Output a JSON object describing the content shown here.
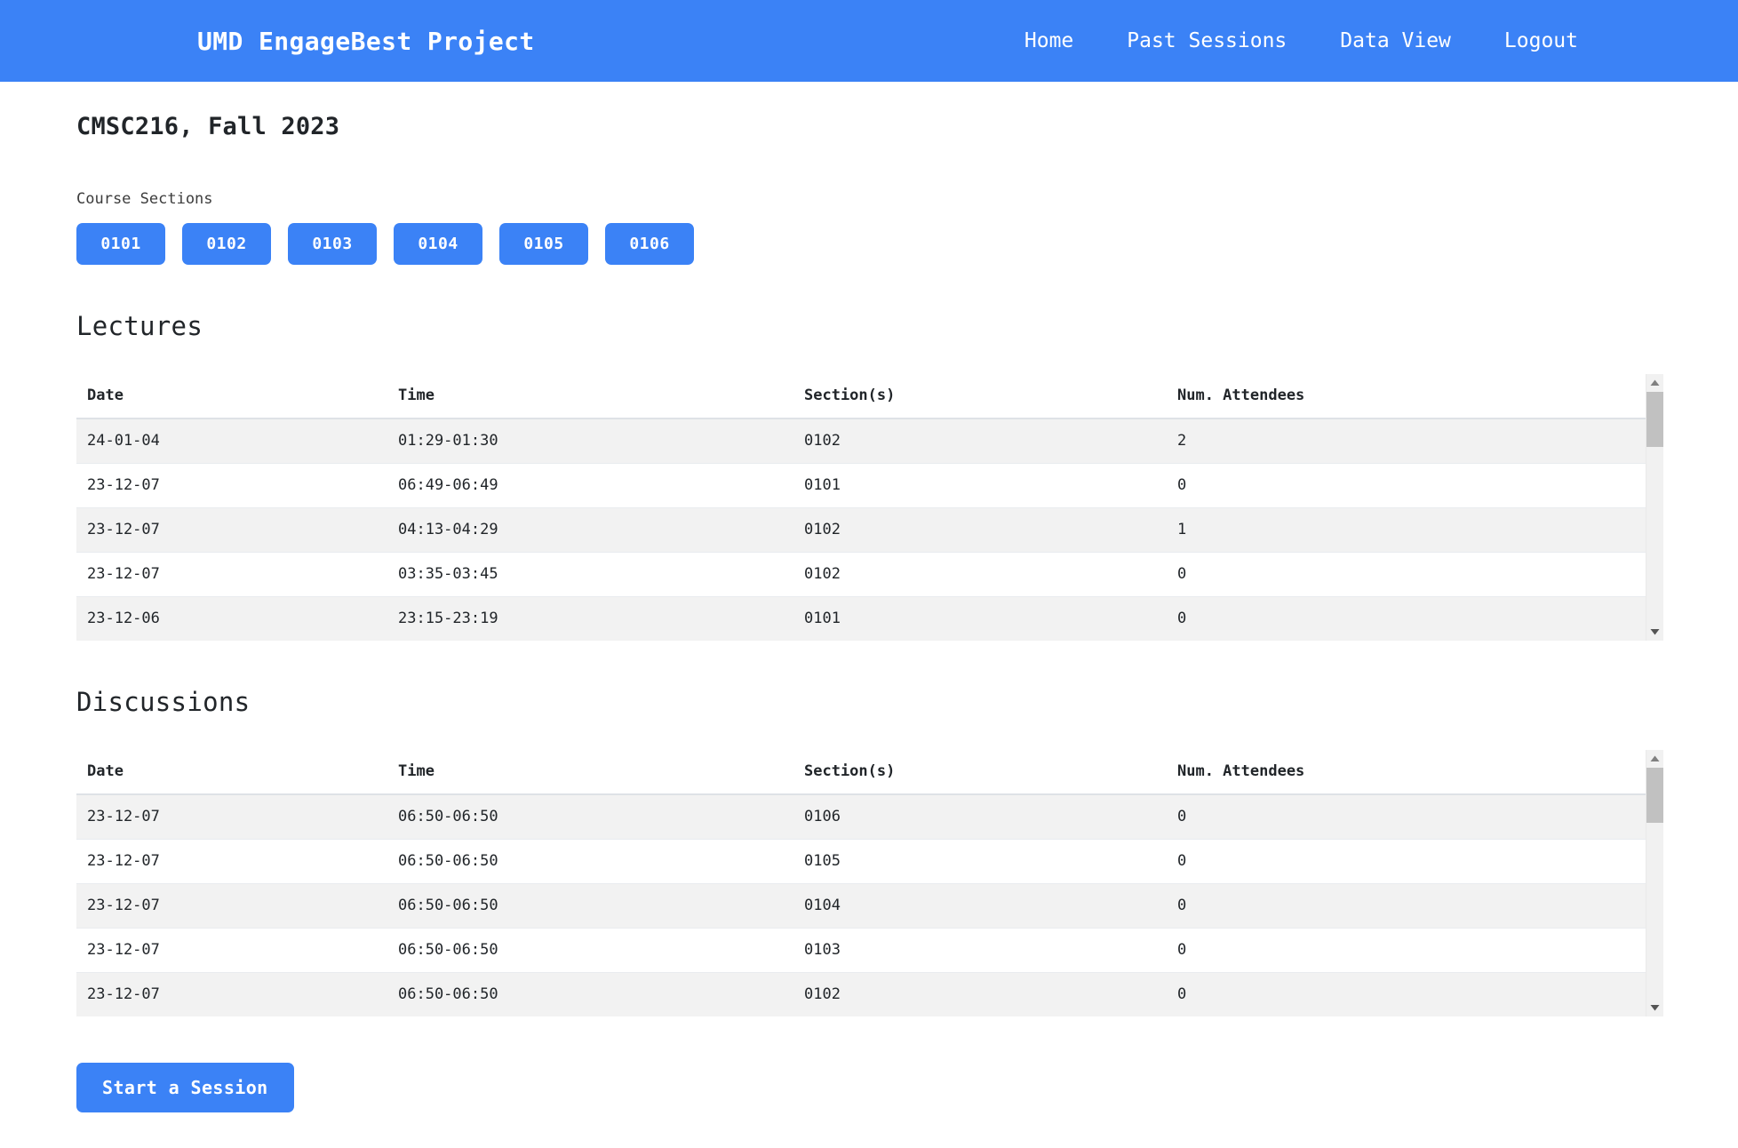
{
  "navbar": {
    "brand": "UMD EngageBest Project",
    "links": [
      {
        "label": "Home"
      },
      {
        "label": "Past Sessions"
      },
      {
        "label": "Data View"
      },
      {
        "label": "Logout"
      }
    ],
    "background_color": "#3b82f6",
    "text_color": "#ffffff"
  },
  "page": {
    "title": "CMSC216, Fall 2023",
    "sections_label": "Course Sections",
    "sections": [
      {
        "label": "0101"
      },
      {
        "label": "0102"
      },
      {
        "label": "0103"
      },
      {
        "label": "0104"
      },
      {
        "label": "0105"
      },
      {
        "label": "0106"
      }
    ],
    "accent_color": "#3b82f6",
    "row_stripe_color": "#f2f2f2"
  },
  "lectures": {
    "heading": "Lectures",
    "columns": [
      "Date",
      "Time",
      "Section(s)",
      "Num. Attendees"
    ],
    "rows": [
      {
        "date": "24-01-04",
        "time": "01:29-01:30",
        "sections": "0102",
        "attendees": "2"
      },
      {
        "date": "23-12-07",
        "time": "06:49-06:49",
        "sections": "0101",
        "attendees": "0"
      },
      {
        "date": "23-12-07",
        "time": "04:13-04:29",
        "sections": "0102",
        "attendees": "1"
      },
      {
        "date": "23-12-07",
        "time": "03:35-03:45",
        "sections": "0102",
        "attendees": "0"
      },
      {
        "date": "23-12-06",
        "time": "23:15-23:19",
        "sections": "0101",
        "attendees": "0"
      }
    ]
  },
  "discussions": {
    "heading": "Discussions",
    "columns": [
      "Date",
      "Time",
      "Section(s)",
      "Num. Attendees"
    ],
    "rows": [
      {
        "date": "23-12-07",
        "time": "06:50-06:50",
        "sections": "0106",
        "attendees": "0"
      },
      {
        "date": "23-12-07",
        "time": "06:50-06:50",
        "sections": "0105",
        "attendees": "0"
      },
      {
        "date": "23-12-07",
        "time": "06:50-06:50",
        "sections": "0104",
        "attendees": "0"
      },
      {
        "date": "23-12-07",
        "time": "06:50-06:50",
        "sections": "0103",
        "attendees": "0"
      },
      {
        "date": "23-12-07",
        "time": "06:50-06:50",
        "sections": "0102",
        "attendees": "0"
      }
    ]
  },
  "footer": {
    "start_session_label": "Start a Session"
  }
}
